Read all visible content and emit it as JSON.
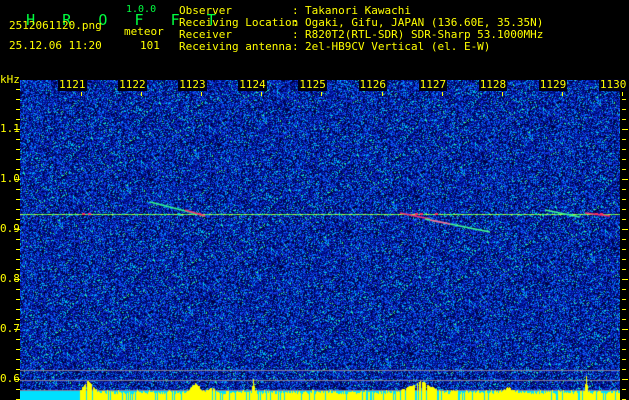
{
  "app": {
    "name_letters": [
      "H",
      "R",
      "O",
      "F",
      "F",
      "T"
    ],
    "version": "1.0.0"
  },
  "file": {
    "name": "2512061120.png",
    "datetime": "25.12.06 11:20"
  },
  "meteor": {
    "label": "meteor",
    "count": "101"
  },
  "info": [
    {
      "label": "Observer",
      "value": "Takanori Kawachi"
    },
    {
      "label": "Receiving Location",
      "value": "Ogaki, Gifu, JAPAN (136.60E, 35.35N)"
    },
    {
      "label": "Receiver",
      "value": "R820T2(RTL-SDR) SDR-Sharp 53.1000MHz"
    },
    {
      "label": "Receiving antenna",
      "value": "2el-HB9CV Vertical (el. E-W)"
    }
  ],
  "axis": {
    "y_unit": "kHz",
    "y_ticks": [
      "1.1",
      "1.0",
      "0.9",
      "0.8",
      "0.7",
      "0.6"
    ],
    "x_ticks": [
      "1121",
      "1122",
      "1123",
      "1124",
      "1125",
      "1126",
      "1127",
      "1128",
      "1129",
      "1130"
    ]
  },
  "colors": {
    "text": "#ffff00",
    "title": "#00ff40",
    "background": "#000000",
    "noise": "#1030d0",
    "carrier": "#40ff60",
    "histogram": "#ffff00",
    "histogram_base": "#00e0ff"
  }
}
